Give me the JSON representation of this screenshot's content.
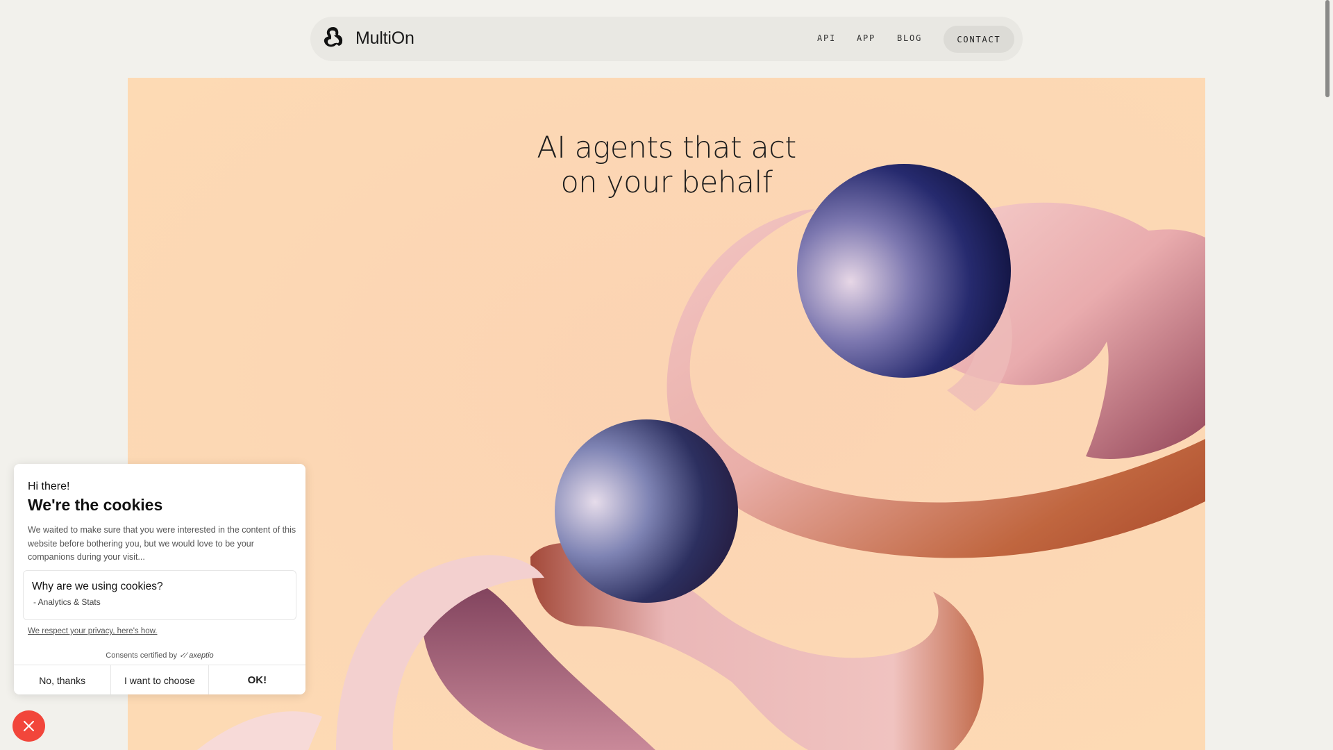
{
  "nav": {
    "brand_name": "MultiOn",
    "links": [
      "API",
      "APP",
      "BLOG"
    ],
    "contact_label": "CONTACT"
  },
  "hero": {
    "title_line1": "AI agents that act",
    "title_line2": "on your behalf",
    "background_color": "#fddab4"
  },
  "cookie": {
    "greeting": "Hi there!",
    "title": "We're the cookies",
    "text": "We waited to make sure that you were interested in the content of this website before bothering you, but we would love to be your companions during your visit...",
    "why_title": "Why are we using cookies?",
    "why_item": "- Analytics & Stats",
    "privacy_link": "We respect your privacy, here's how.",
    "certified_prefix": "Consents certified by",
    "certified_brand": "axeptio",
    "buttons": {
      "no": "No, thanks",
      "choose": "I want to choose",
      "ok": "OK!"
    }
  },
  "colors": {
    "page_bg": "#f2f1ec",
    "close_button": "#f2463b"
  },
  "icons": {
    "brand": "multion-logo-icon",
    "close": "close-icon"
  }
}
